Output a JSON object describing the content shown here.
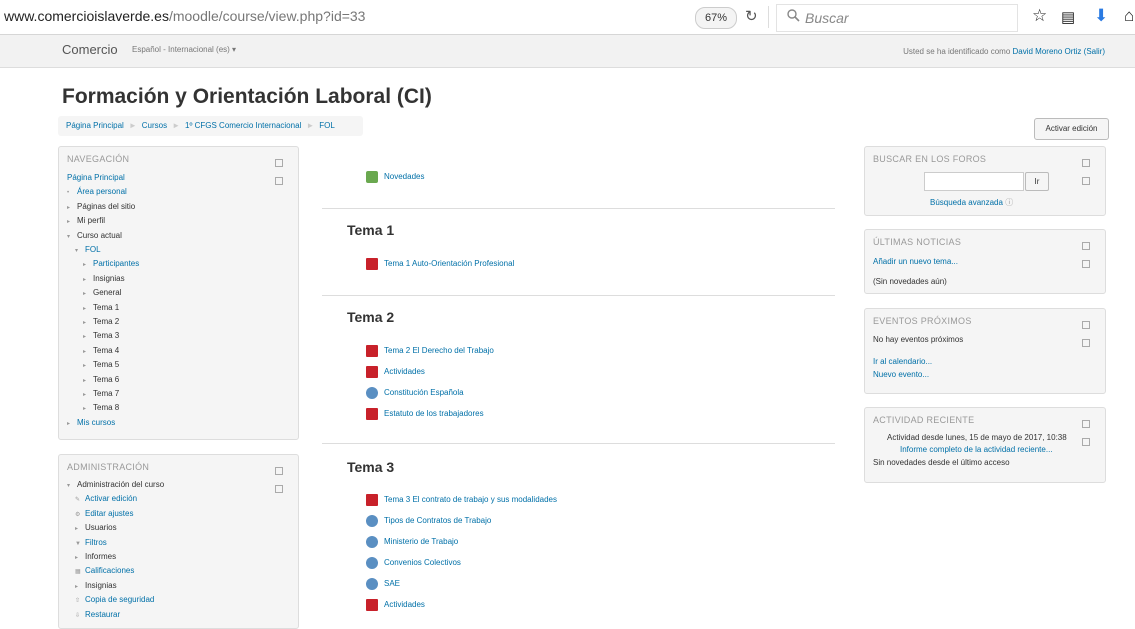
{
  "browser": {
    "url_domain": "www.comercioislaverde.es",
    "url_path": "/moodle/course/view.php?id=33",
    "zoom": "67%",
    "search_placeholder": "Buscar"
  },
  "navbar": {
    "brand": "Comercio",
    "language": "Español - Internacional (es) ▾",
    "login_prefix": "Usted se ha identificado como ",
    "user": "David Moreno Ortiz",
    "logout": "(Salir)"
  },
  "page": {
    "title": "Formación y Orientación Laboral (CI)",
    "breadcrumb": [
      "Página Principal",
      "Cursos",
      "1º CFGS Comercio Internacional",
      "FOL"
    ],
    "edit_button": "Activar edición"
  },
  "navigation": {
    "title": "NAVEGACIÓN",
    "items": [
      {
        "label": "Página Principal",
        "indent": 0,
        "marker": "",
        "link": true
      },
      {
        "label": "Área personal",
        "indent": 0,
        "marker": "•",
        "link": true
      },
      {
        "label": "Páginas del sitio",
        "indent": 0,
        "marker": "▸",
        "link": false
      },
      {
        "label": "Mi perfil",
        "indent": 0,
        "marker": "▸",
        "link": false
      },
      {
        "label": "Curso actual",
        "indent": 0,
        "marker": "▾",
        "link": false
      },
      {
        "label": "FOL",
        "indent": 1,
        "marker": "▾",
        "link": true
      },
      {
        "label": "Participantes",
        "indent": 2,
        "marker": "▸",
        "link": true
      },
      {
        "label": "Insignias",
        "indent": 2,
        "marker": "▸",
        "link": false
      },
      {
        "label": "General",
        "indent": 2,
        "marker": "▸",
        "link": false
      },
      {
        "label": "Tema 1",
        "indent": 2,
        "marker": "▸",
        "link": false
      },
      {
        "label": "Tema 2",
        "indent": 2,
        "marker": "▸",
        "link": false
      },
      {
        "label": "Tema 3",
        "indent": 2,
        "marker": "▸",
        "link": false
      },
      {
        "label": "Tema 4",
        "indent": 2,
        "marker": "▸",
        "link": false
      },
      {
        "label": "Tema 5",
        "indent": 2,
        "marker": "▸",
        "link": false
      },
      {
        "label": "Tema 6",
        "indent": 2,
        "marker": "▸",
        "link": false
      },
      {
        "label": "Tema 7",
        "indent": 2,
        "marker": "▸",
        "link": false
      },
      {
        "label": "Tema 8",
        "indent": 2,
        "marker": "▸",
        "link": false
      },
      {
        "label": "Mis cursos",
        "indent": 0,
        "marker": "▸",
        "link": true
      }
    ]
  },
  "administration": {
    "title": "ADMINISTRACIÓN",
    "items": [
      {
        "label": "Administración del curso",
        "indent": 0,
        "marker": "▾",
        "link": false
      },
      {
        "label": "Activar edición",
        "indent": 1,
        "marker": "✎",
        "link": true
      },
      {
        "label": "Editar ajustes",
        "indent": 1,
        "marker": "⚙",
        "link": true
      },
      {
        "label": "Usuarios",
        "indent": 1,
        "marker": "▸",
        "link": false
      },
      {
        "label": "Filtros",
        "indent": 1,
        "marker": "▼",
        "link": true
      },
      {
        "label": "Informes",
        "indent": 1,
        "marker": "▸",
        "link": false
      },
      {
        "label": "Calificaciones",
        "indent": 1,
        "marker": "▦",
        "link": true
      },
      {
        "label": "Insignias",
        "indent": 1,
        "marker": "▸",
        "link": false
      },
      {
        "label": "Copia de seguridad",
        "indent": 1,
        "marker": "⇧",
        "link": true
      },
      {
        "label": "Restaurar",
        "indent": 1,
        "marker": "⇩",
        "link": true
      }
    ]
  },
  "center": {
    "news": "Novedades",
    "topics": [
      {
        "title": "Tema 1",
        "activities": [
          {
            "label": "Tema 1 Auto-Orientación Profesional",
            "icon": "pdf"
          }
        ]
      },
      {
        "title": "Tema 2",
        "activities": [
          {
            "label": "Tema 2 El Derecho del Trabajo",
            "icon": "pdf"
          },
          {
            "label": "Actividades",
            "icon": "pdf"
          },
          {
            "label": "Constitución Española",
            "icon": "web"
          },
          {
            "label": "Estatuto de los trabajadores",
            "icon": "pdf"
          }
        ]
      },
      {
        "title": "Tema 3",
        "activities": [
          {
            "label": "Tema 3 El contrato de trabajo y sus modalidades",
            "icon": "pdf"
          },
          {
            "label": "Tipos de Contratos de Trabajo",
            "icon": "web"
          },
          {
            "label": "Ministerio de Trabajo",
            "icon": "web"
          },
          {
            "label": "Convenios Colectivos",
            "icon": "web"
          },
          {
            "label": "SAE",
            "icon": "web"
          },
          {
            "label": "Actividades",
            "icon": "pdf"
          }
        ]
      }
    ]
  },
  "forum_search": {
    "title": "BUSCAR EN LOS FOROS",
    "button": "Ir",
    "advanced": "Búsqueda avanzada"
  },
  "news_block": {
    "title": "ÚLTIMAS NOTICIAS",
    "add": "Añadir un nuevo tema...",
    "empty": "(Sin novedades aún)"
  },
  "events": {
    "title": "EVENTOS PRÓXIMOS",
    "empty": "No hay eventos próximos",
    "calendar": "Ir al calendario...",
    "new_event": "Nuevo evento..."
  },
  "recent": {
    "title": "ACTIVIDAD RECIENTE",
    "since": "Actividad desde lunes, 15 de mayo de 2017, 10:38",
    "full_report": "Informe completo de la actividad reciente...",
    "none": "Sin novedades desde el último acceso"
  }
}
